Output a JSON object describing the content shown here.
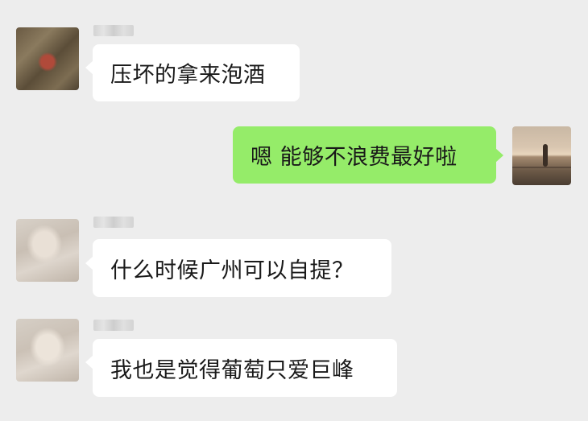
{
  "messages": [
    {
      "direction": "in",
      "sender": "",
      "text": "压坏的拿来泡酒",
      "avatar": "blurred-avatar-icon"
    },
    {
      "direction": "out",
      "text": "嗯 能够不浪费最好啦",
      "avatar": "sunset-avatar-icon"
    },
    {
      "direction": "in",
      "sender": "",
      "text": "什么时候广州可以自提？",
      "avatar": "blurred-avatar-icon"
    },
    {
      "direction": "in",
      "sender": "",
      "text": "我也是觉得葡萄只爱巨峰",
      "avatar": "blurred-avatar-icon"
    }
  ],
  "colors": {
    "background": "#ededed",
    "incoming_bubble": "#ffffff",
    "outgoing_bubble": "#95ec69",
    "text": "#191919"
  }
}
